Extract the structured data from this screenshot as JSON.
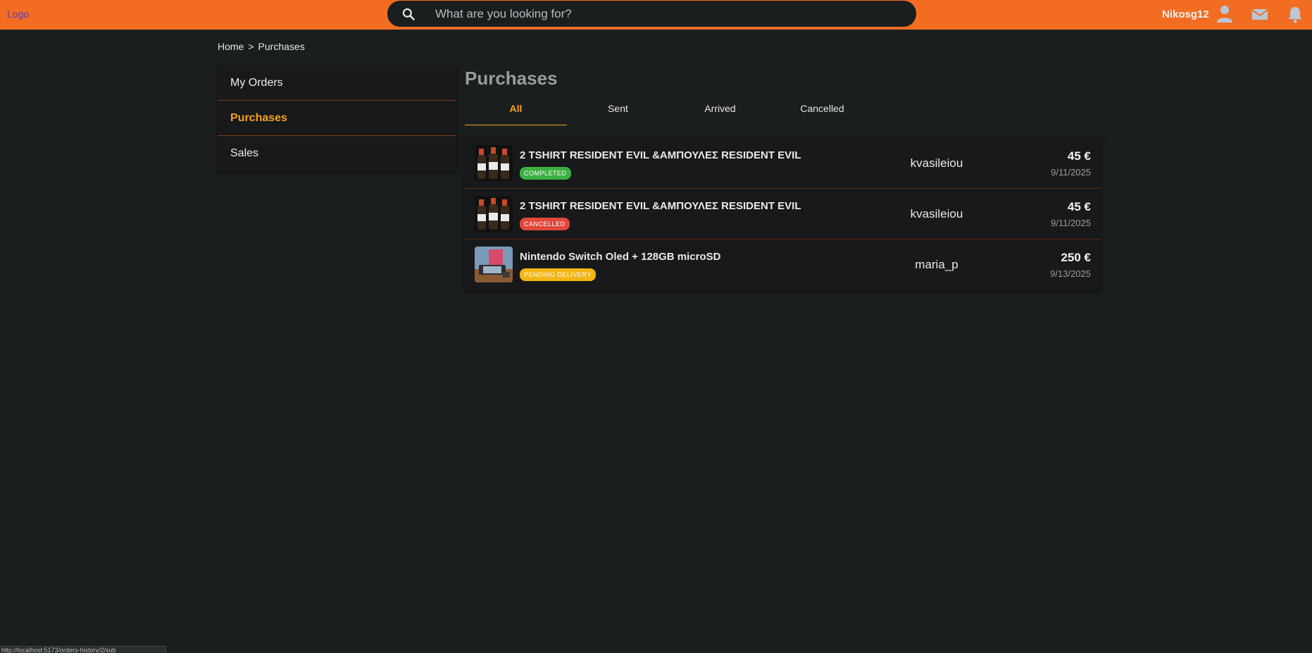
{
  "header": {
    "logo": "Logo",
    "search_placeholder": "What are you looking for?",
    "username": "Nikosg12",
    "icons": [
      "search-icon",
      "user-icon",
      "mail-icon",
      "bell-icon"
    ],
    "brand_color": "#f26d22"
  },
  "breadcrumb": {
    "home": "Home",
    "separator": ">",
    "current": "Purchases"
  },
  "sidebar": {
    "items": [
      {
        "label": "My Orders",
        "active": false
      },
      {
        "label": "Purchases",
        "active": true
      },
      {
        "label": "Sales",
        "active": false
      }
    ]
  },
  "main": {
    "title": "Purchases",
    "tabs": [
      {
        "label": "All",
        "active": true
      },
      {
        "label": "Sent",
        "active": false
      },
      {
        "label": "Arrived",
        "active": false
      },
      {
        "label": "Cancelled",
        "active": false
      }
    ],
    "orders": [
      {
        "title": "2 TSHIRT RESIDENT EVIL &ΑΜΠΟΥΛΕΣ RESIDENT EVIL",
        "status": "COMPLETED",
        "status_color": "#3cb043",
        "seller": "kvasileiou",
        "price": "45 €",
        "date": "9/11/2025"
      },
      {
        "title": "2 TSHIRT RESIDENT EVIL &ΑΜΠΟΥΛΕΣ RESIDENT EVIL",
        "status": "CANCELLED",
        "status_color": "#e2473a",
        "seller": "kvasileiou",
        "price": "45 €",
        "date": "9/11/2025"
      },
      {
        "title": "Nintendo Switch Oled + 128GB microSD",
        "status": "PENDING DELIVERY",
        "status_color": "#f5b416",
        "seller": "maria_p",
        "price": "250 €",
        "date": "9/13/2025"
      }
    ]
  },
  "statusbar": {
    "url": "http://localhost:5173/orders-history/2/sub"
  }
}
